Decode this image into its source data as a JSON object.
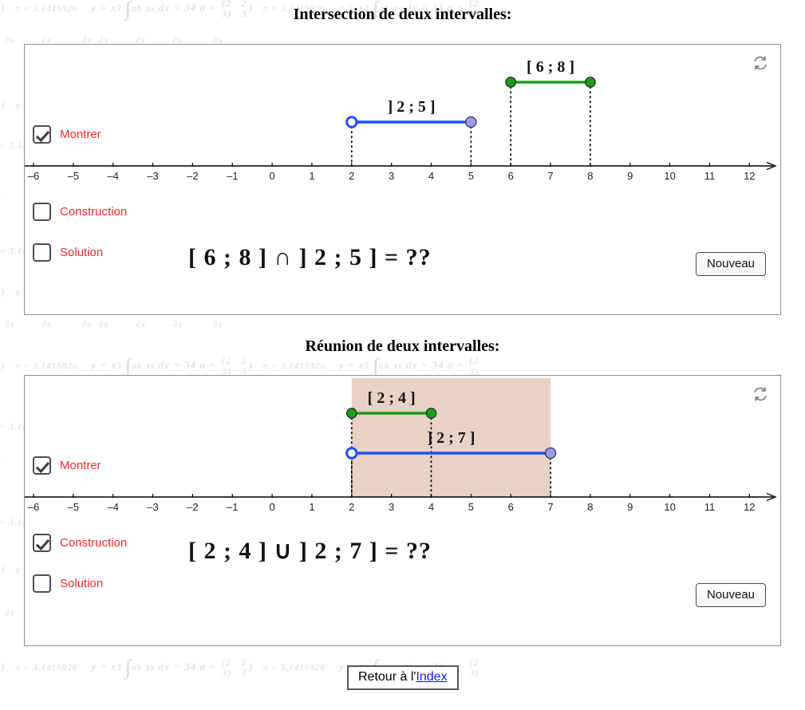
{
  "page": {
    "background_watermark_items": [
      "π = 3,1415926",
      "y = x³",
      "∫₀ᵇ зˣ dx = 34",
      "σ =",
      "∂x",
      "(2 3)"
    ],
    "footer_button": {
      "name": "retour-index-button",
      "text_prefix": "Retour à l'",
      "link_text": "Index"
    }
  },
  "colors": {
    "interval_green": "#1a9e1a",
    "interval_blue": "#1f4fff",
    "endpoint_blue_fill": "#9a9ae8",
    "label_red": "#ff2a2a",
    "shade_fill": "#e8d2c6",
    "axis": "#000000",
    "panel_border": "#8f8f8f"
  },
  "panels": [
    {
      "id": "intersection",
      "title": "Intersection de deux intervalles:",
      "refresh_icon": "refresh-icon",
      "checkboxes": [
        {
          "label": "Montrer",
          "checked": true
        },
        {
          "label": "Construction",
          "checked": false
        },
        {
          "label": "Solution",
          "checked": false
        }
      ],
      "axis": {
        "min": -6,
        "max": 12,
        "ticks": [
          "–6",
          "–5",
          "–4",
          "–3",
          "–2",
          "–1",
          "0",
          "1",
          "2",
          "3",
          "4",
          "5",
          "6",
          "7",
          "8",
          "9",
          "10",
          "11",
          "12"
        ]
      },
      "intervals": [
        {
          "label": "[ 6 ; 8 ]",
          "color": "green",
          "start": 6,
          "end": 8,
          "left_open": false,
          "right_open": false,
          "row": 0
        },
        {
          "label": "] 2 ; 5 ]",
          "color": "blue",
          "start": 2,
          "end": 5,
          "left_open": true,
          "right_open": false,
          "row": 1
        }
      ],
      "equation": "[ 6 ; 8 ]  ∩  ] 2 ; 5 ]  =  ??",
      "new_button": "Nouveau",
      "shaded": null
    },
    {
      "id": "reunion",
      "title": "Réunion de deux intervalles:",
      "refresh_icon": "refresh-icon",
      "checkboxes": [
        {
          "label": "Montrer",
          "checked": true
        },
        {
          "label": "Construction",
          "checked": true
        },
        {
          "label": "Solution",
          "checked": false
        }
      ],
      "axis": {
        "min": -6,
        "max": 12,
        "ticks": [
          "–6",
          "–5",
          "–4",
          "–3",
          "–2",
          "–1",
          "0",
          "1",
          "2",
          "3",
          "4",
          "5",
          "6",
          "7",
          "8",
          "9",
          "10",
          "11",
          "12"
        ]
      },
      "intervals": [
        {
          "label": "[ 2 ; 4 ]",
          "color": "green",
          "start": 2,
          "end": 4,
          "left_open": false,
          "right_open": false,
          "row": 0
        },
        {
          "label": "] 2 ; 7 ]",
          "color": "blue",
          "start": 2,
          "end": 7,
          "left_open": true,
          "right_open": false,
          "row": 1
        }
      ],
      "equation": "[ 2 ; 4 ]  ∪  ] 2 ; 7 ]  =  ??",
      "new_button": "Nouveau",
      "shaded": {
        "start": 2,
        "end": 7
      }
    }
  ]
}
